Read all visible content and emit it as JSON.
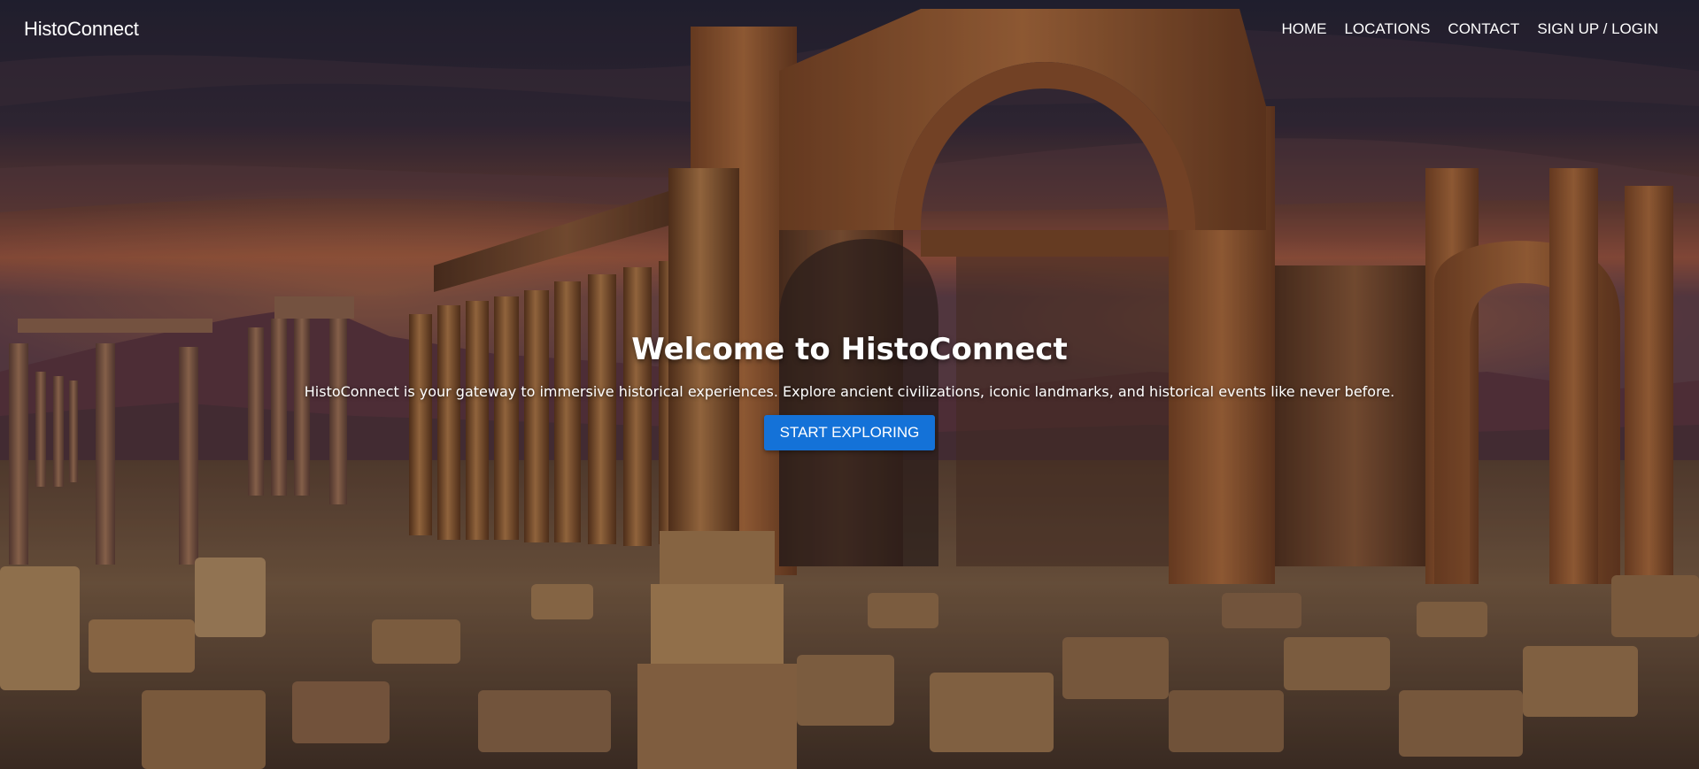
{
  "navbar": {
    "brand": "HistoConnect",
    "links": [
      {
        "label": "HOME"
      },
      {
        "label": "LOCATIONS"
      },
      {
        "label": "CONTACT"
      },
      {
        "label": "SIGN UP / LOGIN"
      }
    ]
  },
  "hero": {
    "title": "Welcome to HistoConnect",
    "description": "HistoConnect is your gateway to immersive historical experiences. Explore ancient civilizations, iconic landmarks, and historical events like never before.",
    "cta_label": "START EXPLORING",
    "background_image": "ruins-arch-colonnade-sunset",
    "colors": {
      "cta_bg": "#1472d8",
      "text": "#ffffff"
    }
  }
}
